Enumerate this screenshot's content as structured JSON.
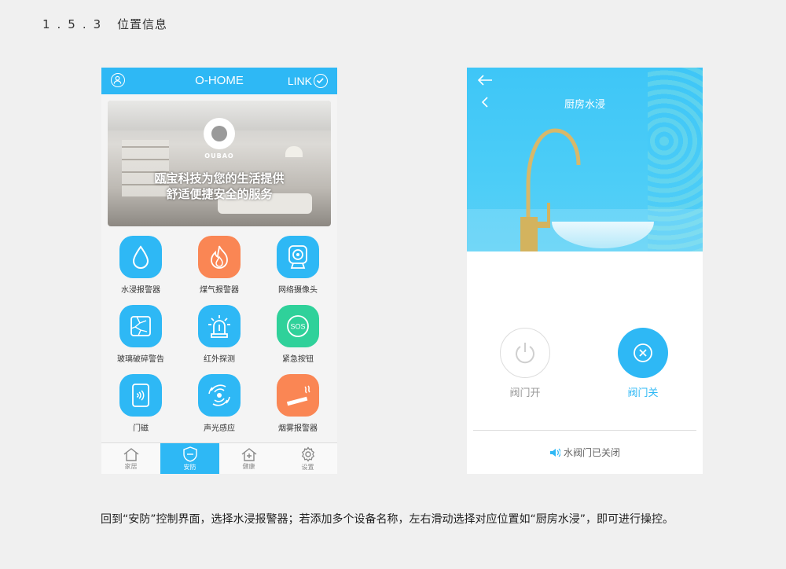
{
  "section": {
    "number": "1.5.3",
    "title": "位置信息"
  },
  "phone1": {
    "header": {
      "title": "O-HOME",
      "link_label": "LINK"
    },
    "banner": {
      "brand": "OUBAO",
      "slogan_line1": "瓯宝科技为您的生活提供",
      "slogan_line2": "舒适便捷安全的服务"
    },
    "devices": [
      {
        "label": "水浸报警器",
        "color": "blue",
        "icon": "water-drop-icon"
      },
      {
        "label": "煤气报警器",
        "color": "orange",
        "icon": "flame-icon"
      },
      {
        "label": "网络摄像头",
        "color": "blue",
        "icon": "camera-icon"
      },
      {
        "label": "玻璃破碎警告",
        "color": "blue",
        "icon": "broken-glass-icon"
      },
      {
        "label": "红外探测",
        "color": "blue",
        "icon": "siren-icon"
      },
      {
        "label": "紧急按钮",
        "color": "green",
        "icon": "sos-icon"
      },
      {
        "label": "门磁",
        "color": "blue",
        "icon": "door-sensor-icon"
      },
      {
        "label": "声光感应",
        "color": "blue",
        "icon": "sound-light-icon"
      },
      {
        "label": "烟雾报警器",
        "color": "orange",
        "icon": "cigarette-icon"
      }
    ],
    "tabs": [
      {
        "label": "家居",
        "icon": "home-icon",
        "active": false
      },
      {
        "label": "安防",
        "icon": "shield-icon",
        "active": true
      },
      {
        "label": "健康",
        "icon": "health-icon",
        "active": false
      },
      {
        "label": "设置",
        "icon": "gear-icon",
        "active": false
      }
    ]
  },
  "phone2": {
    "title": "厨房水浸",
    "valve_open_label": "阀门开",
    "valve_close_label": "阀门关",
    "status": "水阀门已关闭"
  },
  "caption": "回到“安防”控制界面，选择水浸报警器；若添加多个设备名称，左右滑动选择对应位置如“厨房水浸”，即可进行操控。",
  "colors": {
    "accent": "#2eb8f5",
    "orange": "#fa8654",
    "green": "#2fd19a"
  }
}
